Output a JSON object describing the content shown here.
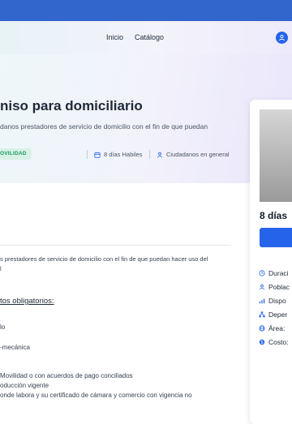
{
  "nav": {
    "links": [
      "Inicio",
      "Catálogo"
    ]
  },
  "hero": {
    "title": "niso para domiciliario",
    "description": "danos prestadores de servicio de domicilio con el fin de que puedan",
    "category": "OVILIDAD",
    "meta": {
      "duration": "8 días Habiles",
      "audience": "Ciudadanos en general"
    }
  },
  "card": {
    "days": "8 días",
    "rows": [
      "Duraci",
      "Poblac",
      "Dispo",
      "Deper",
      "Área:",
      "Costo:"
    ]
  },
  "content": {
    "intro": "s prestadores de servicio de domicilio con el fin de que puedan hacer uso del",
    "intro_cont": "l",
    "requirements_title": "tos obligatorios:",
    "requirements": [
      "lo",
      "-mecánica",
      "Movilidad o con acuerdos de pago conciliados",
      "oducción vigente",
      "onde labora y su certificado de cámara y comercio con vigencia no"
    ]
  },
  "colors": {
    "brand": "#3366cc",
    "accent": "#2563eb",
    "badge_bg": "#d8f1e6",
    "badge_text": "#179a65"
  }
}
